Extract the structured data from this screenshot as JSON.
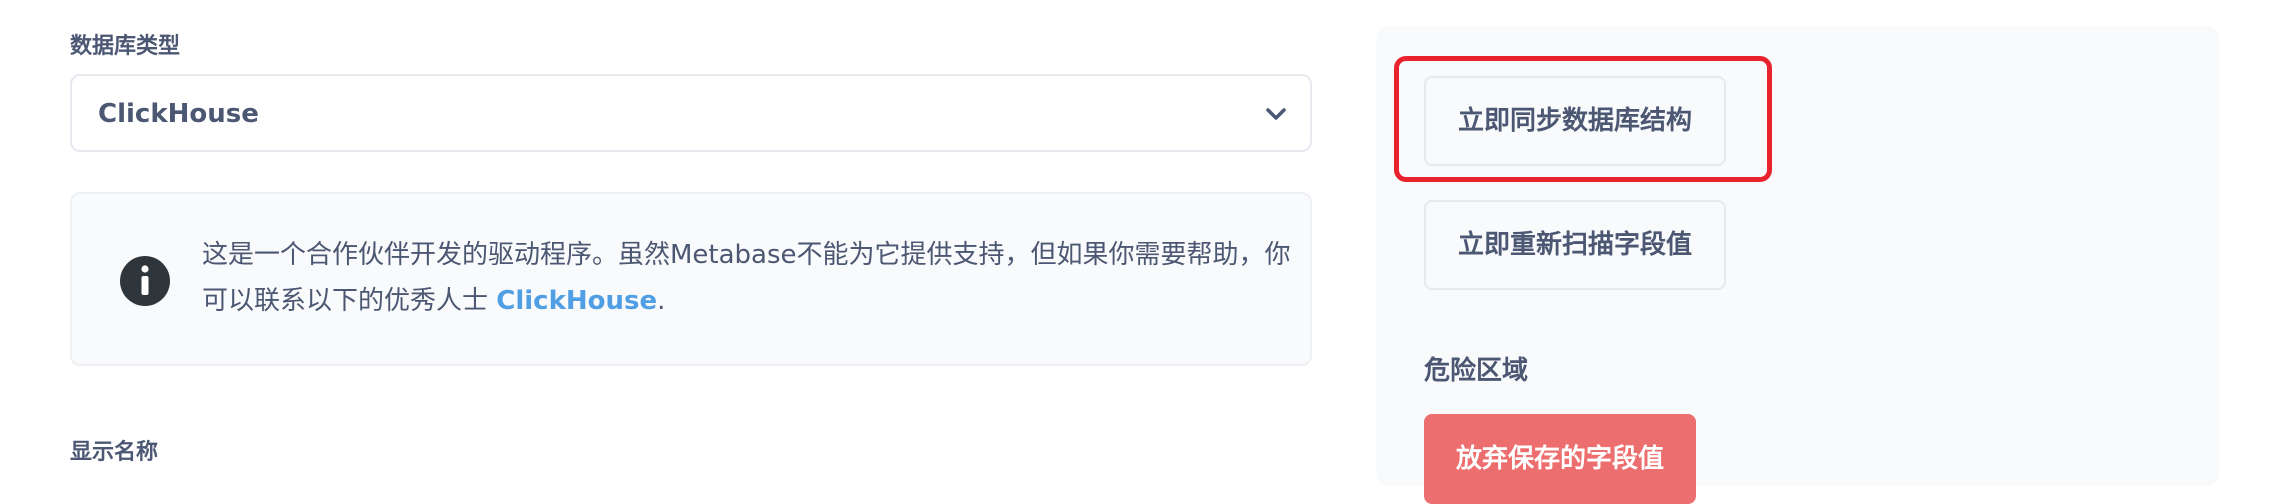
{
  "form": {
    "db_type_label": "数据库类型",
    "db_type_value": "ClickHouse",
    "info_text": "这是一个合作伙伴开发的驱动程序。虽然Metabase不能为它提供支持，但如果你需要帮助，你可以联系以下的优秀人士 ",
    "info_link": "ClickHouse",
    "info_suffix": ".",
    "display_name_label": "显示名称"
  },
  "sidebar": {
    "sync_button": "立即同步数据库结构",
    "rescan_button": "立即重新扫描字段值",
    "danger_title": "危险区域",
    "discard_button": "放弃保存的字段值"
  },
  "colors": {
    "accent": "#509ee3",
    "danger": "#ed6e6e",
    "highlight": "#e8232e",
    "text": "#4c5773"
  },
  "icons": {
    "select_chevron": "chevron-down-icon",
    "info": "info-icon"
  }
}
